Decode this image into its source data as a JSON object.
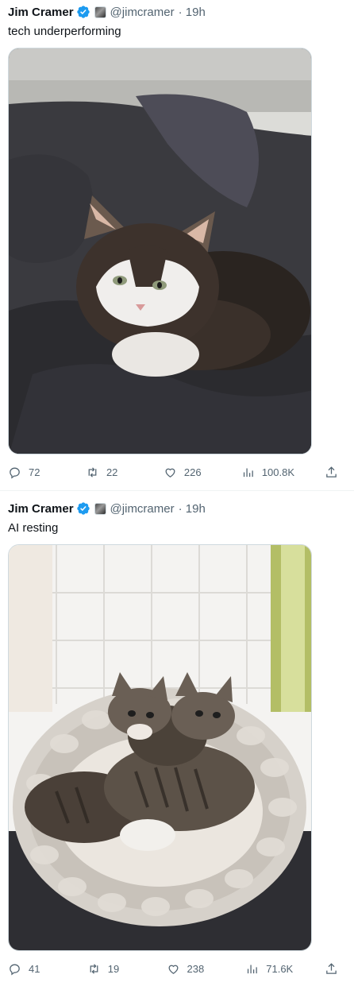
{
  "tweets": [
    {
      "author": {
        "name": "Jim Cramer",
        "handle": "@jimcramer"
      },
      "time": "· 19h",
      "text": "tech underperforming",
      "stats": {
        "replies": "72",
        "retweets": "22",
        "likes": "226",
        "views": "100.8K"
      }
    },
    {
      "author": {
        "name": "Jim Cramer",
        "handle": "@jimcramer"
      },
      "time": "· 19h",
      "text": "AI resting",
      "stats": {
        "replies": "41",
        "retweets": "19",
        "likes": "238",
        "views": "71.6K"
      }
    }
  ],
  "icons": {
    "verified": "verified-badge-icon",
    "affiliation": "affiliation-avatar-icon",
    "reply": "reply-icon",
    "retweet": "retweet-icon",
    "like": "heart-icon",
    "views": "views-chart-icon",
    "share": "share-icon"
  },
  "colors": {
    "text": "#0f1419",
    "secondary": "#536471",
    "verified": "#1d9bf0",
    "divider": "#eff3f4"
  }
}
